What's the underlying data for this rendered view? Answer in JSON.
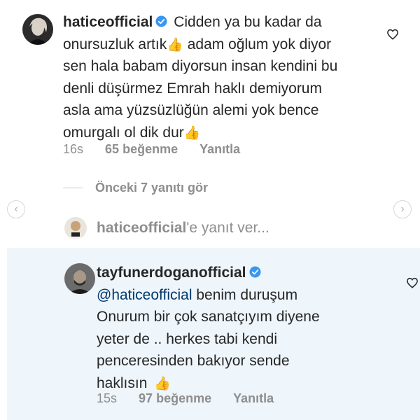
{
  "comments": [
    {
      "username": "haticeofficial",
      "text_lines": [
        "Cidden ya bu kadar da",
        "onursuzluk artık",
        "adam oğlum yok diyor",
        "sen hala babam diyorsun insan kendini bu",
        "denli düşürmez Emrah haklı demiyorum",
        "asla ama yüzsüzlüğün alemi yok bence",
        "omurgalı ol dik dur"
      ],
      "time": "16s",
      "likes": "65 beğenme",
      "reply": "Yanıtla"
    },
    {
      "username": "tayfunerdoganofficial",
      "mention": "@haticeofficial",
      "text_lines": [
        "benim duruşum",
        "Onurum bir çok sanatçıyım diyene",
        "yeter de .. herkes  tabi kendi",
        "penceresinden bakıyor  sende",
        "haklısın"
      ],
      "time": "15s",
      "likes": "97 beğenme",
      "reply": "Yanıtla"
    }
  ],
  "view_replies": "Önceki 7 yanıtı gör",
  "reply_box": {
    "username": "haticeofficial",
    "suffix": "'e yanıt ver..."
  },
  "emoji": "👍",
  "icons": {
    "verified": "verified-badge-icon",
    "like": "heart-outline-icon",
    "prev": "chevron-left-icon",
    "next": "chevron-right-icon"
  },
  "colors": {
    "verified": "#3897f0",
    "muted": "#8e8e8e",
    "mention": "#00376b",
    "highlight": "#eef5fb"
  }
}
